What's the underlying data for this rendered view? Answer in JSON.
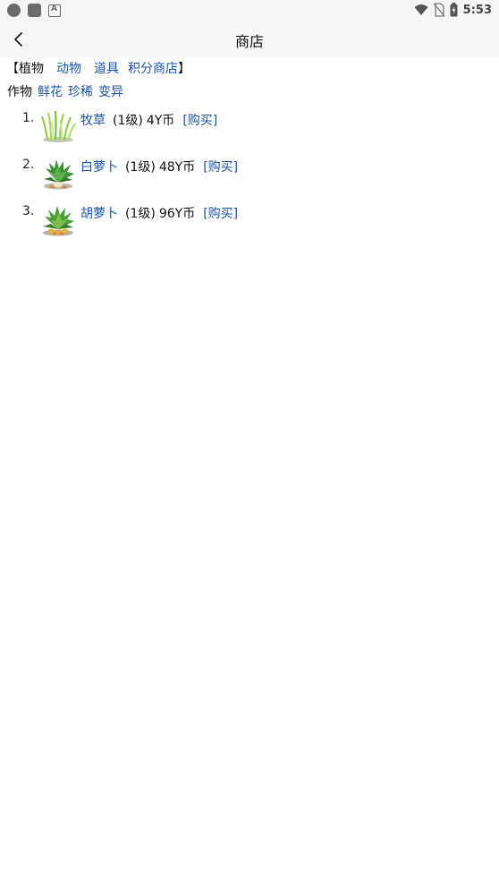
{
  "status": {
    "time": "5:53"
  },
  "appbar": {
    "title": "商店"
  },
  "categories": {
    "open": "【",
    "current": "植物",
    "links": [
      "动物",
      "道具",
      "积分商店"
    ],
    "close": "】"
  },
  "subcategories": {
    "current": "作物",
    "links": [
      "鲜花",
      "珍稀",
      "变异"
    ]
  },
  "items": [
    {
      "index": "1.",
      "name": "牧草",
      "level": "(1级)",
      "price": "4Y币",
      "buy": "[购买]"
    },
    {
      "index": "2.",
      "name": "白萝卜",
      "level": "(1级)",
      "price": "48Y币",
      "buy": "[购买]"
    },
    {
      "index": "3.",
      "name": "胡萝卜",
      "level": "(1级)",
      "price": "96Y币",
      "buy": "[购买]"
    }
  ],
  "colors": {
    "link": "#1a56a8",
    "appbar_bg": "#f7f7f7"
  },
  "icons": [
    "circle-status-icon",
    "square-status-icon",
    "a-status-icon",
    "wifi-icon",
    "no-sim-icon",
    "battery-icon",
    "back-arrow-icon",
    "grass-icon",
    "white-radish-icon",
    "carrot-icon"
  ]
}
